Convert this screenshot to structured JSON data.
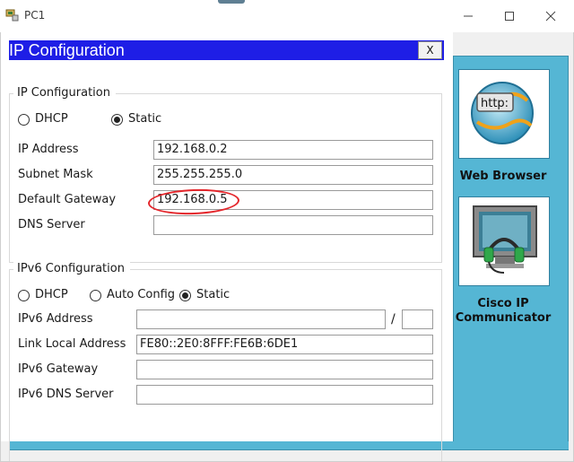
{
  "window": {
    "title": "PC1",
    "min_glyph": "—",
    "max_glyph": "☐",
    "close_glyph": "✕"
  },
  "dialog": {
    "title": "IP Configuration",
    "close_label": "X",
    "ipv4": {
      "legend": "IP Configuration",
      "dhcp_label": "DHCP",
      "static_label": "Static",
      "mode": "Static",
      "ip_address_label": "IP Address",
      "ip_address": "192.168.0.2",
      "subnet_mask_label": "Subnet Mask",
      "subnet_mask": "255.255.255.0",
      "gateway_label": "Default Gateway",
      "gateway": "192.168.0.5",
      "dns_label": "DNS Server",
      "dns": ""
    },
    "ipv6": {
      "legend": "IPv6 Configuration",
      "dhcp_label": "DHCP",
      "auto_label": "Auto Config",
      "static_label": "Static",
      "mode": "Static",
      "address_label": "IPv6 Address",
      "address": "",
      "prefix_separator": "/",
      "prefix": "",
      "link_local_label": "Link Local Address",
      "link_local": "FE80::2E0:8FFF:FE6B:6DE1",
      "gateway_label": "IPv6 Gateway",
      "gateway": "",
      "dns_label": "IPv6 DNS Server",
      "dns": ""
    }
  },
  "desktop": {
    "apps": [
      {
        "label": "Web Browser",
        "icon": "web-browser-icon",
        "icon_text": "http:"
      },
      {
        "label": "Cisco IP\nCommunicator",
        "icon": "ip-communicator-icon"
      }
    ]
  },
  "colors": {
    "title_bar": "#1e1ee6",
    "desktop": "#55b6d4",
    "annotation": "#e4262b"
  }
}
